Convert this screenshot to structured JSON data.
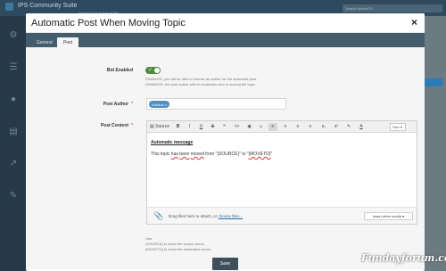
{
  "background": {
    "app_title": "IPS Community Suite",
    "signed_in": "Signed in as Admin  ▾  Site",
    "search_placeholder": "Search AdminCP..."
  },
  "modal": {
    "title": "Automatic Post When Moving Topic",
    "close_label": "×",
    "tabs": [
      {
        "label": "General",
        "active": false
      },
      {
        "label": "Post",
        "active": true
      }
    ]
  },
  "form": {
    "bot_enabled": {
      "label": "Bot Enabled",
      "toggle_on": true,
      "help_line1": "ENABLED, you will be able to choose an author for the automatic post.",
      "help_line2": "DISABLED, the post author will be moderator who is moving the topic."
    },
    "post_author": {
      "label": "Post Author",
      "required_mark": "*",
      "token": "Adriano ×"
    },
    "post_content": {
      "label": "Post Content",
      "required_mark": "*",
      "toolbar": {
        "source_label": "Source",
        "buttons": [
          "B",
          "I",
          "U",
          "S",
          "❝",
          "<>",
          "◉",
          "☺",
          "≡",
          "≡",
          "≡",
          "≡",
          "x₂",
          "x²",
          "✎",
          "A"
        ],
        "size_label": "Size ▾"
      },
      "heading": "Automatic message",
      "line_prefix": "This topic ",
      "word_has": "has",
      "word_been": "been",
      "word_moved": "moved",
      "line_mid": " from \"{SOURCE}\" to \"",
      "word_moveto": "{MOVETO}",
      "line_end": "\"",
      "drag_text": "Drag files here to attach, or ",
      "choose_files": "choose files...",
      "insert_media": "Insert other media ▾"
    },
    "use_help": {
      "line1": "Use:",
      "line2": "{SOURCE} to show the source forum,",
      "line3": "{MOVETO} to show the destination forum."
    },
    "save_label": "Save"
  },
  "watermark": "Fundayforum.com",
  "colors": {
    "tabbar": "#445d6c",
    "toggle_on": "#4e8a3c",
    "token": "#4f8fc4",
    "save_button": "#3d4f5b"
  }
}
